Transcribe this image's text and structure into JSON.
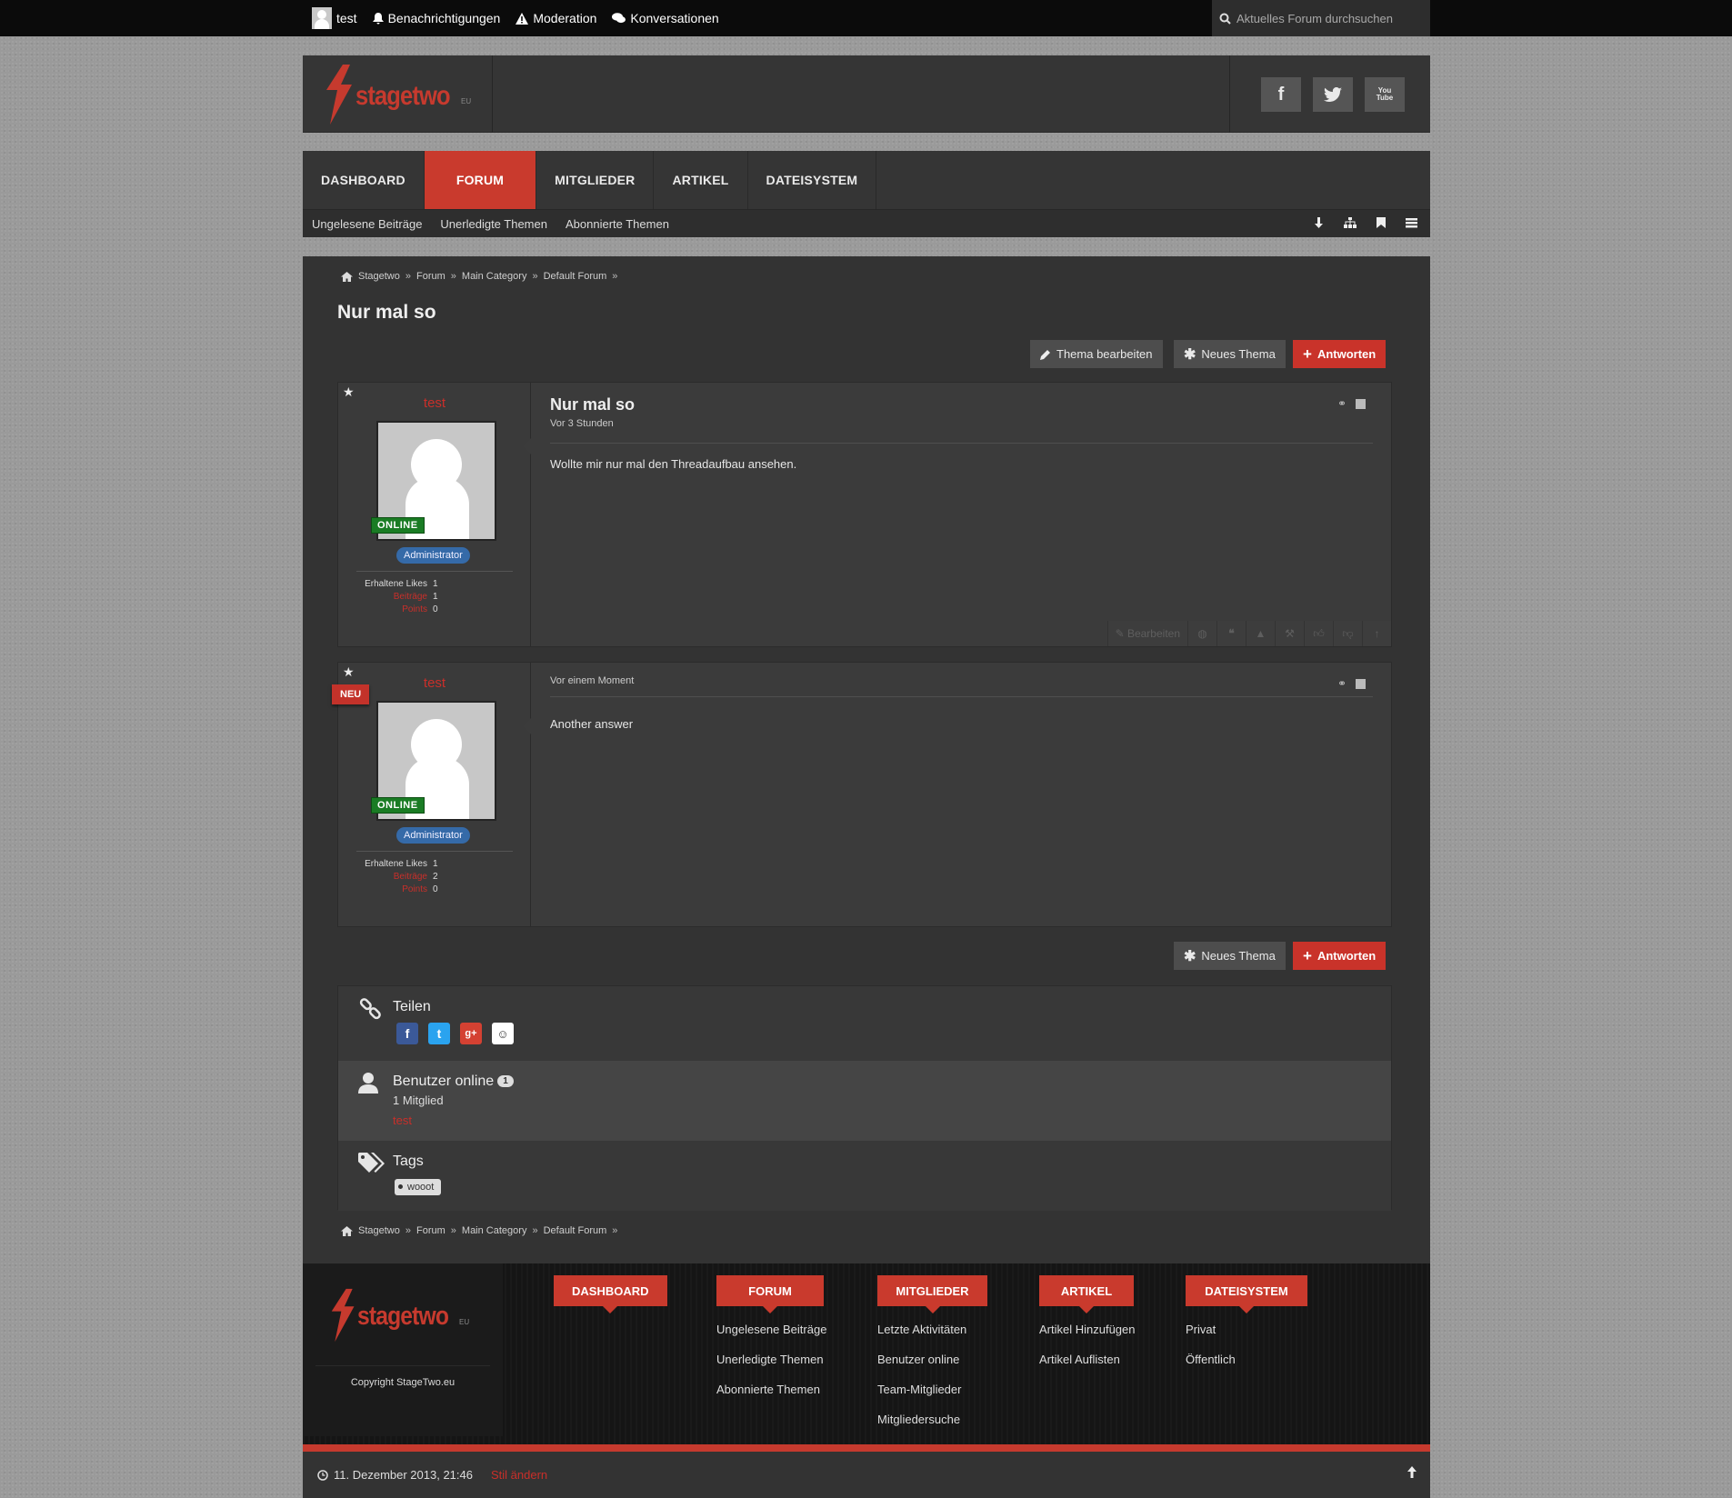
{
  "topbar": {
    "username": "test",
    "notifications": "Benachrichtigungen",
    "moderation": "Moderation",
    "conversations": "Konversationen",
    "search_placeholder": "Aktuelles Forum durchsuchen"
  },
  "header": {
    "logo_text": "stagetwo",
    "logo_suffix": "EU",
    "social": [
      "f",
      "t",
      "You Tube"
    ]
  },
  "nav": {
    "tabs": [
      "DASHBOARD",
      "FORUM",
      "MITGLIEDER",
      "ARTIKEL",
      "DATEISYSTEM"
    ],
    "active": "FORUM",
    "subnav": [
      "Ungelesene Beiträge",
      "Unerledigte Themen",
      "Abonnierte Themen"
    ]
  },
  "breadcrumb": [
    "Stagetwo",
    "Forum",
    "Main Category",
    "Default Forum"
  ],
  "breadcrumb_sep": "»",
  "thread": {
    "title": "Nur mal so",
    "edit_button": "Thema bearbeiten",
    "new_button": "Neues Thema",
    "reply_button": "Antworten"
  },
  "posts": [
    {
      "username": "test",
      "online": "ONLINE",
      "role": "Administrator",
      "likes_label": "Erhaltene Likes",
      "likes": "1",
      "posts_label": "Beiträge",
      "posts": "1",
      "points_label": "Points",
      "points": "0",
      "title": "Nur mal so",
      "time": "Vor 3 Stunden",
      "text": "Wollte mir nur mal den Threadaufbau ansehen.",
      "edit_label": "Bearbeiten"
    },
    {
      "username": "test",
      "new_badge": "NEU",
      "online": "ONLINE",
      "role": "Administrator",
      "likes_label": "Erhaltene Likes",
      "likes": "1",
      "posts_label": "Beiträge",
      "posts": "2",
      "points_label": "Points",
      "points": "0",
      "time": "Vor einem Moment",
      "text": "Another answer"
    }
  ],
  "share": {
    "title": "Teilen"
  },
  "online_users": {
    "title": "Benutzer online",
    "count": "1",
    "members": "1 Mitglied",
    "user": "test"
  },
  "tags": {
    "title": "Tags",
    "items": [
      "wooot"
    ]
  },
  "footer": {
    "logo_text": "stagetwo",
    "logo_suffix": "EU",
    "copyright": "Copyright StageTwo.eu",
    "columns": [
      {
        "head": "DASHBOARD",
        "links": []
      },
      {
        "head": "FORUM",
        "links": [
          "Ungelesene Beiträge",
          "Unerledigte Themen",
          "Abonnierte Themen"
        ]
      },
      {
        "head": "MITGLIEDER",
        "links": [
          "Letzte Aktivitäten",
          "Benutzer online",
          "Team-Mitglieder",
          "Mitgliedersuche"
        ]
      },
      {
        "head": "ARTIKEL",
        "links": [
          "Artikel Hinzufügen",
          "Artikel Auflisten"
        ]
      },
      {
        "head": "DATEISYSTEM",
        "links": [
          "Privat",
          "Öffentlich"
        ]
      }
    ]
  },
  "bottombar": {
    "date": "11. Dezember 2013, 21:46",
    "style_link": "Stil ändern"
  },
  "colors": {
    "accent": "#c93a2d",
    "online": "#1a7c24",
    "role": "#356aa8",
    "background": "#333333"
  }
}
